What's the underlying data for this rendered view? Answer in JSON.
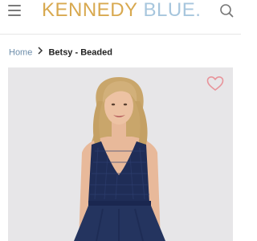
{
  "header": {
    "brand_word1": "KENNEDY",
    "brand_word2": "BLUE.",
    "menu_icon": "hamburger-menu-icon",
    "search_icon": "search-icon",
    "brand_colors": {
      "gold": "#d8a950",
      "blue": "#a7c6dd"
    }
  },
  "breadcrumb": {
    "home": "Home",
    "separator_icon": "chevron-right-icon",
    "current": "Betsy - Beaded"
  },
  "product": {
    "image_subject": "model wearing navy lace-bodice dress",
    "favorite_icon": "heart-outline-icon",
    "favorite_color": "#e8939a",
    "dress_color": "#1e2c55"
  }
}
